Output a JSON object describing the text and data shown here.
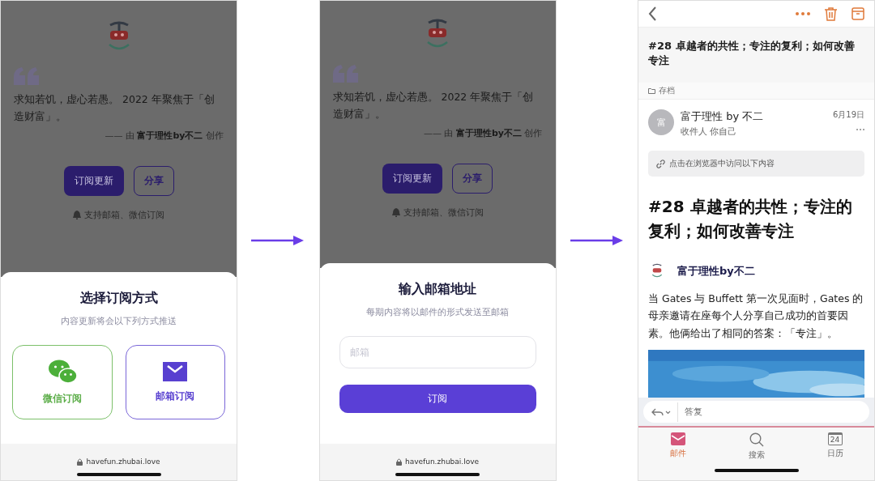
{
  "screens": [
    {
      "kind": "method_sheet",
      "page": {
        "quote": "求知若饥，虚心若愚。 2022 年聚焦于「创造财富」。",
        "attribution": "—— 由 **富于理性by不二** 创作",
        "buttons": [
          "订阅更新",
          "分享"
        ],
        "note": "支持邮箱、微信订阅"
      },
      "sheet": {
        "title": "选择订阅方式",
        "subtitle": "内容更新将会以下列方式推送",
        "options": [
          {
            "kind": "wechat",
            "label": "微信订阅"
          },
          {
            "kind": "email",
            "label": "邮箱订阅"
          }
        ]
      },
      "url": "havefun.zhubai.love"
    },
    {
      "kind": "email_sheet",
      "page": {
        "quote": "求知若饥，虚心若愚。 2022 年聚焦于「创造财富」。",
        "attribution": "—— 由 **富于理性by不二** 创作",
        "buttons": [
          "订阅更新",
          "分享"
        ],
        "note": "支持邮箱、微信订阅"
      },
      "sheet": {
        "title": "输入邮箱地址",
        "subtitle": "每期内容将以邮件的形式发送至邮箱",
        "field": {
          "placeholder": "邮箱"
        },
        "submit": "订阅"
      },
      "url": "havefun.zhubai.love"
    },
    {
      "kind": "mail",
      "subject": "#28 卓越者的共性；专注的复利；如何改善专注",
      "folder": "存档",
      "sender": {
        "avatar": "富",
        "name": "富于理性 by 不二",
        "recipient": "收件人 你自己",
        "date": "6月19日"
      },
      "browser_link": "点击在浏览器中访问以下内容",
      "heading": "#28 卓越者的共性；专注的复利；如何改善专注",
      "author": "富于理性by不二",
      "body": "当 Gates 与 Buffett 第一次见面时，Gates 的母亲邀请在座每个人分享自己成功的首要因素。他俩给出了相同的答案：「专注」。",
      "reply": {
        "placeholder": "答复"
      },
      "tabs": [
        {
          "kind": "mail",
          "label": "邮件",
          "selected": true
        },
        {
          "kind": "search",
          "label": "搜索",
          "selected": false
        },
        {
          "kind": "calendar",
          "label": "日历",
          "selected": false,
          "day": "24"
        }
      ]
    }
  ]
}
